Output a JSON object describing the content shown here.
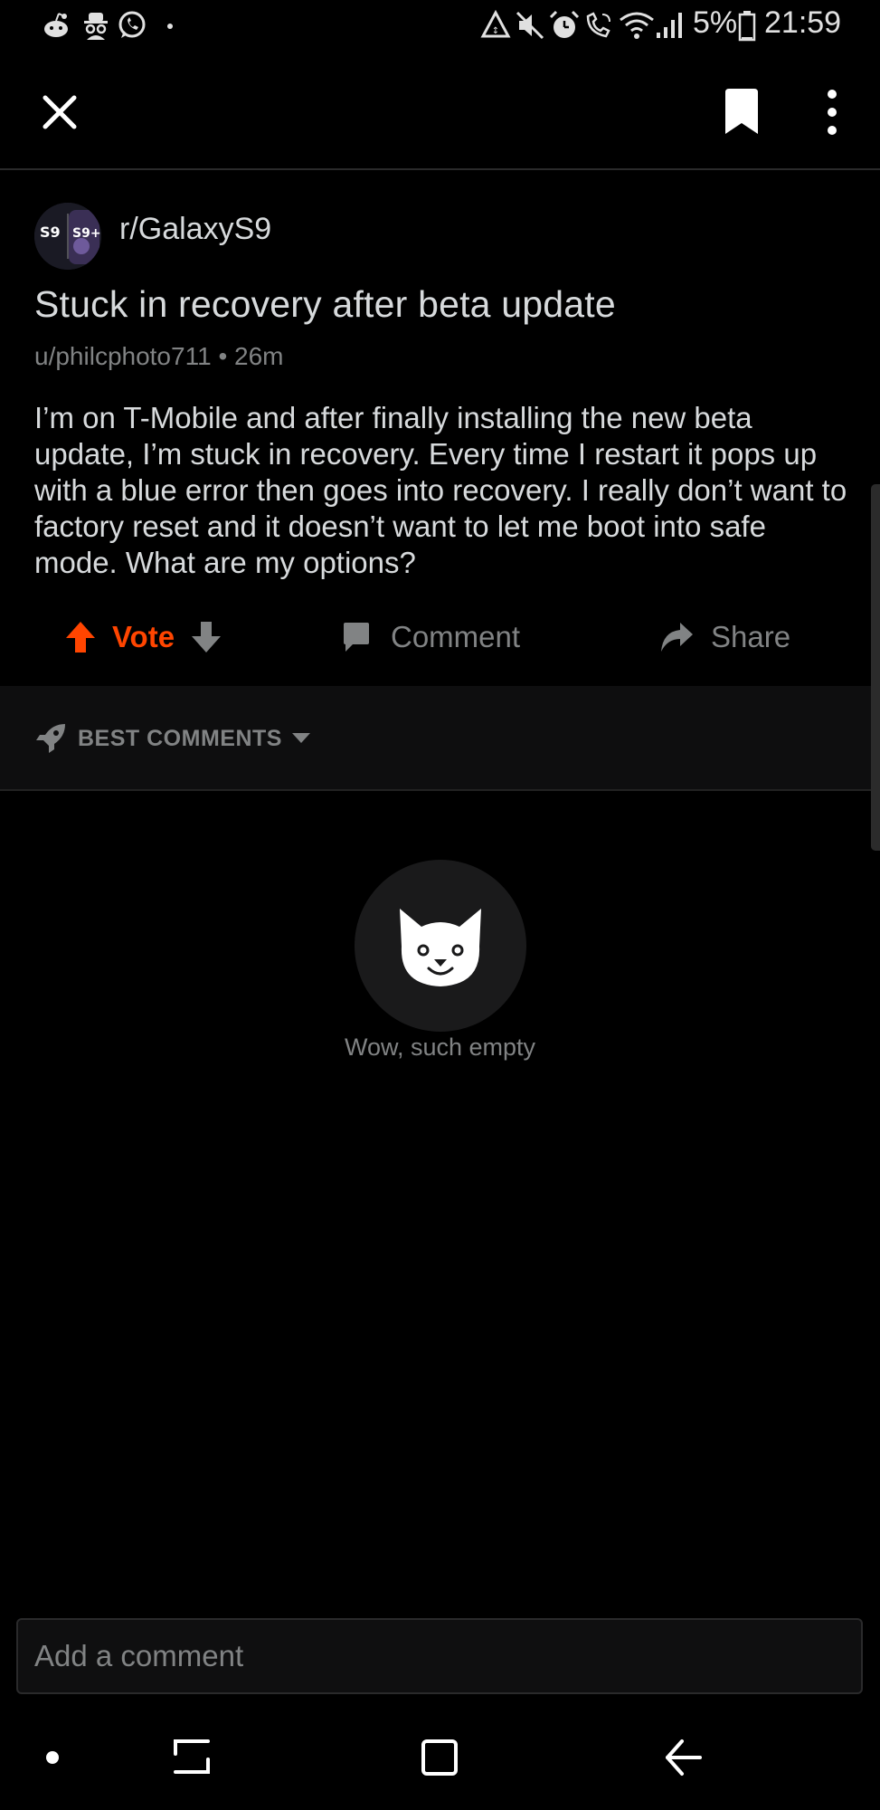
{
  "status_bar": {
    "battery_percent": "5%",
    "time": "21:59",
    "left_icons": [
      "reddit-icon",
      "incognito-icon",
      "whatsapp-icon",
      "dot-icon"
    ],
    "right_icons": [
      "data-saver-icon",
      "mute-icon",
      "alarm-icon",
      "wifi-calling-icon",
      "wifi-icon",
      "signal-icon",
      "battery-icon"
    ]
  },
  "toolbar": {
    "close_icon": "close-icon",
    "save_icon": "bookmark-icon",
    "more_icon": "more-vertical-icon"
  },
  "post": {
    "subreddit": "r/GalaxyS9",
    "title": "Stuck in recovery after beta update",
    "author": "u/philcphoto711",
    "separator": "•",
    "age": "26m",
    "body": "I’m on T-Mobile and after finally installing the new beta update, I’m stuck in recovery. Every time I restart it pops up with a blue error then goes into recovery. I really don’t want to factory reset and it doesn’t want to let me boot into safe mode. What are my options?"
  },
  "actions": {
    "vote_label": "Vote",
    "comment_label": "Comment",
    "share_label": "Share"
  },
  "comments": {
    "sort_label": "BEST COMMENTS",
    "empty_text": "Wow, such empty"
  },
  "comment_box": {
    "placeholder": "Add a comment"
  },
  "colors": {
    "accent": "#ff4500",
    "background": "#000000",
    "text_primary": "#d7dadc",
    "text_secondary": "#818384"
  }
}
